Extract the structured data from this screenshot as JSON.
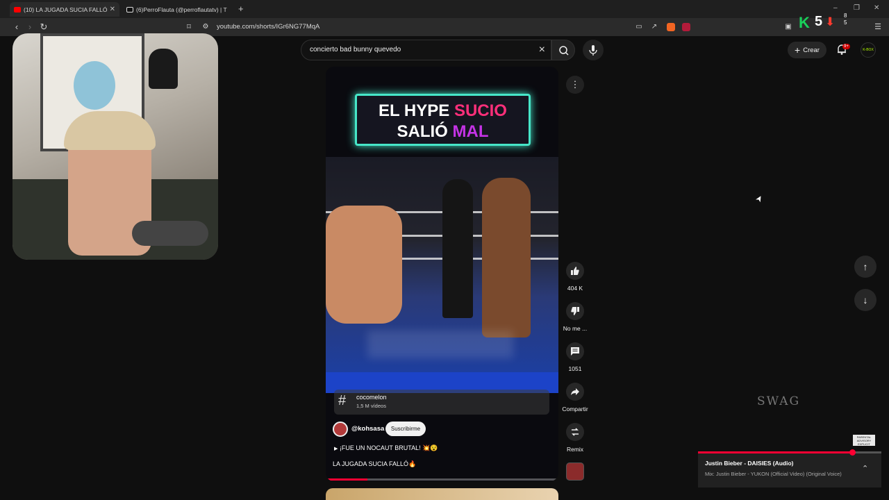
{
  "browser": {
    "tabs": [
      {
        "title": "(10) LA JUGADA SUCIA FALLÓ",
        "active": true
      },
      {
        "title": "(6)PerroFlauta (@perroflautatv) | T",
        "active": false
      }
    ],
    "new_tab": "+",
    "url": "youtube.com/shorts/IGr6NG77MqA",
    "window_controls": [
      "–",
      "❐",
      "✕"
    ]
  },
  "youtube": {
    "search": {
      "query": "concierto bad bunny quevedo"
    },
    "create_label": "Crear",
    "notifications_badge": "9+",
    "account_badge": "K-BOX"
  },
  "video": {
    "titlecard": {
      "line1_white": "EL HYPE ",
      "line1_accent": "SUCIO",
      "line2_white": "SALIÓ ",
      "line2_accent": "MAL"
    },
    "hashtag": {
      "name": "cocomelon",
      "count": "1,5 M vídeos"
    },
    "channel": "@kohsasa",
    "subscribe_label": "Suscribirme",
    "audio_text": "¡FUE UN NOCAUT BRUTAL! 💥😵",
    "caption": "LA JUGADA SUCIA FALLÓ🔥",
    "progress": 0.18
  },
  "actions": {
    "like_count": "404 K",
    "dislike_label": "No me ...",
    "comments_count": "1051",
    "share_label": "Compartir",
    "remix_label": "Remix"
  },
  "music": {
    "title": "Justin Bieber - DAISIES (Audio)",
    "subtitle": "Mix: Justin Bieber - YUKON (Official Video) (Original Voice)",
    "progress": 0.84,
    "art_text": "SWAG",
    "advisory_text": "PARENTAL ADVISORY EXPLICIT CONTENT"
  },
  "stream_overlay": {
    "k_letter": "K",
    "number": "5",
    "counts": [
      "8",
      "5"
    ]
  },
  "colors": {
    "accent_red": "#ff0033",
    "title_pink": "#ff2f7a",
    "title_purple": "#c533e6",
    "title_border": "#46e6c8"
  }
}
